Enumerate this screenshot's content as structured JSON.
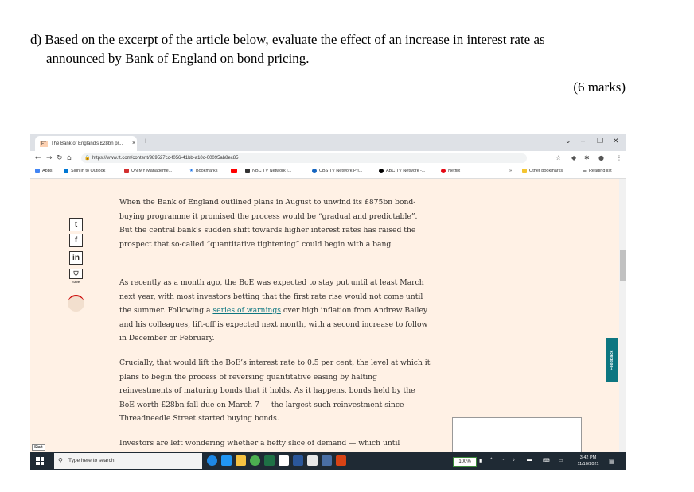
{
  "question": {
    "line1": "d) Based on the excerpt of the article below, evaluate the effect of an increase in interest rate as",
    "line2": "announced by Bank of England on bond pricing.",
    "marks": "(6 marks)"
  },
  "browser": {
    "tab_title": "The Bank of England's £28bn pr...",
    "tab_favicon": "FT",
    "new_tab": "+",
    "url": "https://www.ft.com/content/989527cc-f056-41bb-a10c-00095ab8ec85",
    "bookmarks": [
      {
        "label": "Apps",
        "color": "#4285f4"
      },
      {
        "label": "Sign in to Outlook",
        "color": "#0078d4"
      },
      {
        "label": "UNIMY Manageme...",
        "color": "#d32f2f"
      },
      {
        "label": "Bookmarks",
        "color": "#1a73e8"
      },
      {
        "label": "",
        "color": "#ff0000"
      },
      {
        "label": "NBC TV Network |...",
        "color": "#333333"
      },
      {
        "label": "CBS TV Network Pri...",
        "color": "#1565c0"
      },
      {
        "label": "ABC TV Network -...",
        "color": "#000000"
      },
      {
        "label": "Netflix",
        "color": "#e50914"
      }
    ],
    "bookmarks_overflow": "»",
    "other_bookmarks": "Other bookmarks",
    "reading_list": "Reading list"
  },
  "article": {
    "share": {
      "twitter": "t",
      "facebook": "f",
      "linkedin": "in",
      "save_label": "Save"
    },
    "p1": "When the Bank of England outlined plans in August to unwind its £875bn bond-buying programme it promised the process would be “gradual and predictable”. But the central bank’s sudden shift towards higher interest rates has raised the prospect that so-called “quantitative tightening” could begin with a bang.",
    "p2_before": "As recently as a month ago, the BoE was expected to stay put until at least March next year, with most investors betting that the first rate rise would not come until the summer. Following a ",
    "p2_link": "series of warnings",
    "p2_after": " over high inflation from Andrew Bailey and his colleagues, lift-off is expected next month, with a second increase to follow in December or February.",
    "p3": "Crucially, that would lift the BoE’s interest rate to 0.5 per cent, the level at which it plans to begin the process of reversing quantitative easing by halting reinvestments of maturing bonds that it holds. As it happens, bonds held by the BoE worth £28bn fall due on March 7 — the largest such reinvestment since Threadneedle Street started buying bonds.",
    "p4": "Investors are left wondering whether a hefty slice of demand — which until"
  },
  "feedback_label": "Feedback",
  "start_label": "Start",
  "taskbar": {
    "search_placeholder": "Type here to search",
    "zoom": "100%",
    "time": "3:42 PM",
    "date": "11/10/2021"
  }
}
